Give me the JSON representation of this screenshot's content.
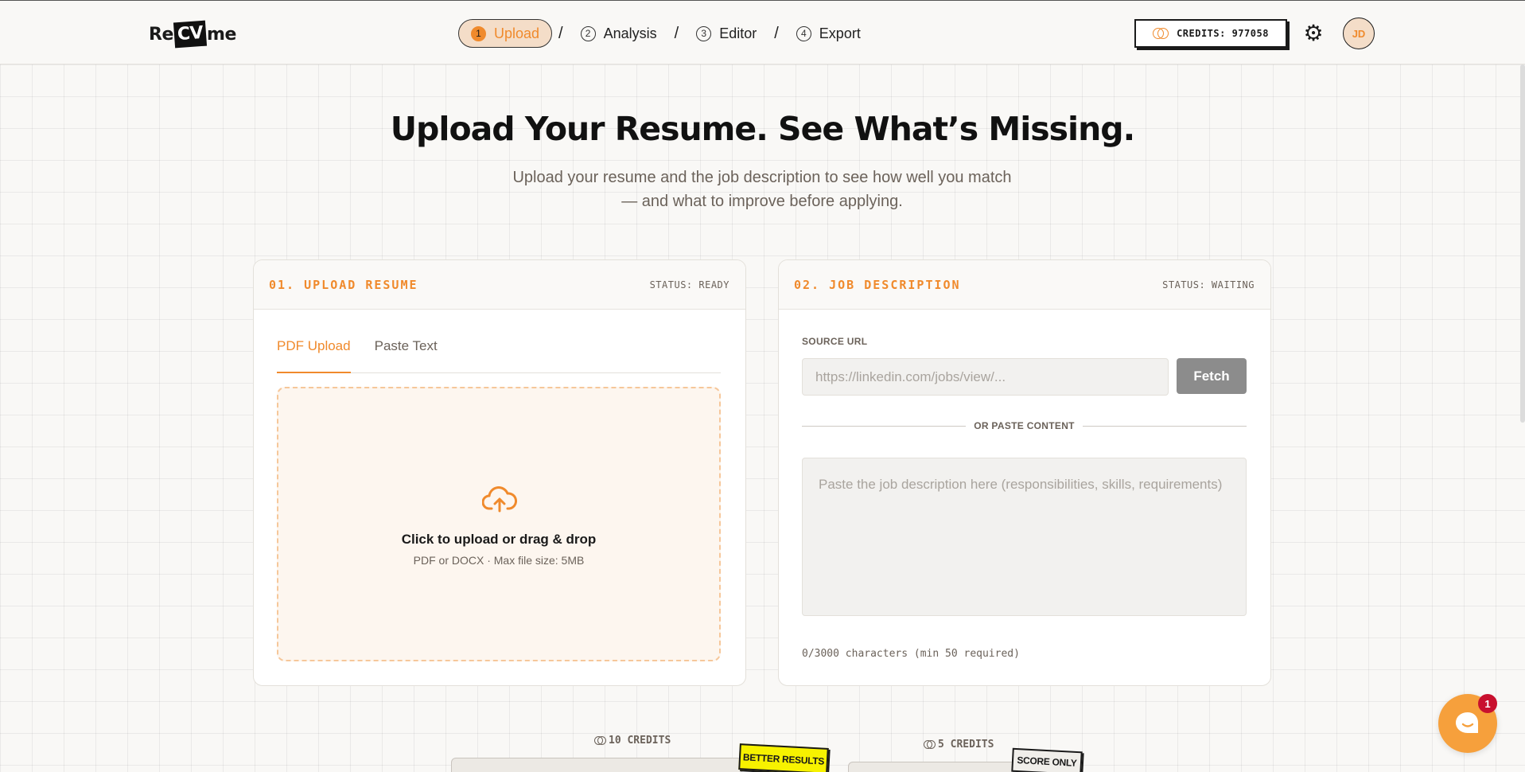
{
  "brand": {
    "pre": "Re",
    "mid": "CV",
    "post": "me"
  },
  "steps": [
    {
      "num": "1",
      "label": "Upload",
      "active": true
    },
    {
      "num": "2",
      "label": "Analysis",
      "active": false
    },
    {
      "num": "3",
      "label": "Editor",
      "active": false
    },
    {
      "num": "4",
      "label": "Export",
      "active": false
    }
  ],
  "step_separator": "/",
  "header": {
    "credits": "CREDITS: 977058",
    "avatar_initials": "JD"
  },
  "hero": {
    "title": "Upload Your Resume. See What’s Missing.",
    "subtitle": "Upload your resume and the job description to see how well you match — and what to improve before applying."
  },
  "resume_card": {
    "title": "01. UPLOAD RESUME",
    "status": "STATUS: READY",
    "tabs": [
      "PDF Upload",
      "Paste Text"
    ],
    "dropzone_title": "Click to upload or drag & drop",
    "dropzone_sub": "PDF or DOCX · Max file size: 5MB"
  },
  "jd_card": {
    "title": "02. JOB DESCRIPTION",
    "status": "STATUS: WAITING",
    "source_label": "SOURCE URL",
    "url_placeholder": "https://linkedin.com/jobs/view/...",
    "url_value": "",
    "fetch_label": "Fetch",
    "divider_label": "OR PASTE CONTENT",
    "textarea_placeholder": "Paste the job description here (responsibilities, skills, requirements)",
    "counter": "0/3000 characters (min 50 required)"
  },
  "options": [
    {
      "cost": "10 CREDITS",
      "badge": "BETTER RESULTS"
    },
    {
      "cost": "5 CREDITS",
      "badge": "SCORE ONLY"
    }
  ],
  "chat": {
    "unread": "1"
  },
  "colors": {
    "accent": "#f08a2c",
    "accent_soft": "#f4ddc8",
    "badge_yellow": "#f7f200",
    "notify_red": "#c8102e"
  },
  "icons": [
    "coins-icon",
    "gear-icon",
    "cloud-upload-icon",
    "chat-bubble-icon"
  ]
}
